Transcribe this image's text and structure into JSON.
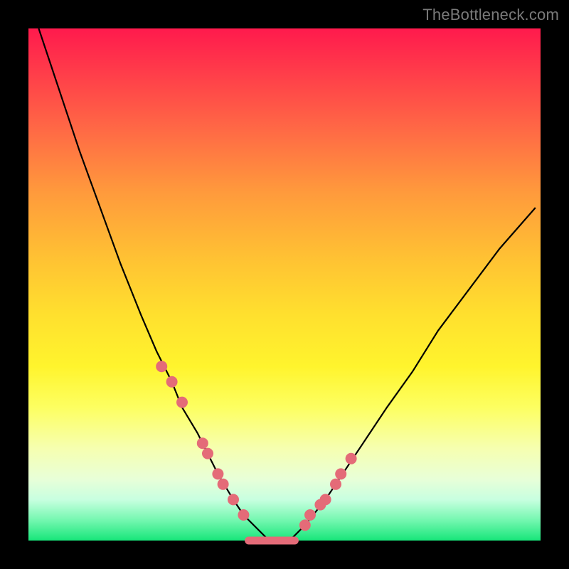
{
  "watermark": "TheBottleneck.com",
  "chart_data": {
    "type": "line",
    "title": "",
    "xlabel": "",
    "ylabel": "",
    "x_range": [
      0,
      100
    ],
    "y_range": [
      0,
      100
    ],
    "grid": false,
    "legend": false,
    "background_gradient": {
      "top_color": "#ff1a4d",
      "bottom_color": "#17e67a",
      "orientation": "vertical",
      "meaning": "red-high-bottleneck green-low-bottleneck"
    },
    "series": [
      {
        "name": "bottleneck-curve",
        "x": [
          2,
          6,
          10,
          14,
          18,
          22,
          25,
          28,
          30,
          33,
          35,
          37,
          40,
          42,
          45,
          47,
          49,
          51,
          54,
          58,
          62,
          66,
          70,
          75,
          80,
          86,
          92,
          99
        ],
        "values": [
          100,
          88,
          76,
          65,
          54,
          44,
          37,
          31,
          26,
          21,
          17,
          13,
          8,
          5,
          2,
          0,
          0,
          0,
          3,
          8,
          14,
          20,
          26,
          33,
          41,
          49,
          57,
          65
        ]
      }
    ],
    "highlighted_points": {
      "name": "sample-points",
      "x": [
        26,
        28,
        30,
        34,
        35,
        37,
        38,
        40,
        42,
        54,
        55,
        57,
        58,
        60,
        61,
        63
      ],
      "values": [
        34,
        31,
        27,
        19,
        17,
        13,
        11,
        8,
        5,
        3,
        5,
        7,
        8,
        11,
        13,
        16
      ]
    },
    "minimum_segment": {
      "x_start": 43,
      "x_end": 52,
      "value": 0
    }
  }
}
